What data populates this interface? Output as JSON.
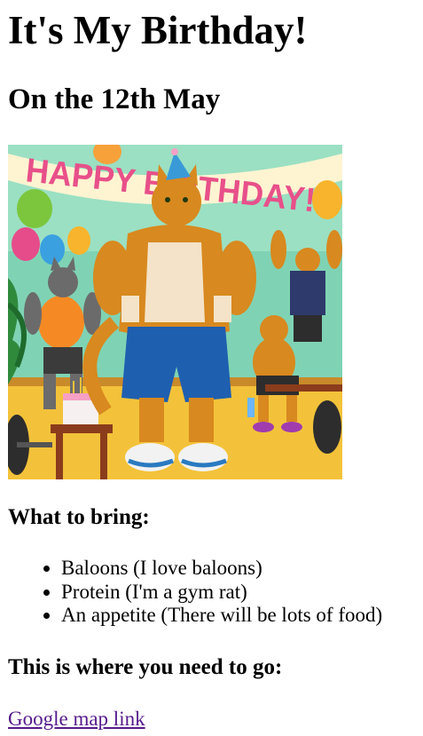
{
  "page": {
    "title": "It's My Birthday!",
    "date_heading": "On the 12th May"
  },
  "hero_image": {
    "banner_text": "HAPPY BIRTHDAY!!",
    "description_alt": "Muscular cartoon cats celebrating a birthday in a gym"
  },
  "bring": {
    "heading": "What to bring:",
    "items": [
      "Baloons (I love baloons)",
      "Protein (I'm a gym rat)",
      "An appetite (There will be lots of food)"
    ]
  },
  "location": {
    "heading": "This is where you need to go:",
    "link_text": "Google map link"
  },
  "colors": {
    "link_visited": "#551a8b",
    "text": "#000000",
    "background": "#ffffff"
  }
}
